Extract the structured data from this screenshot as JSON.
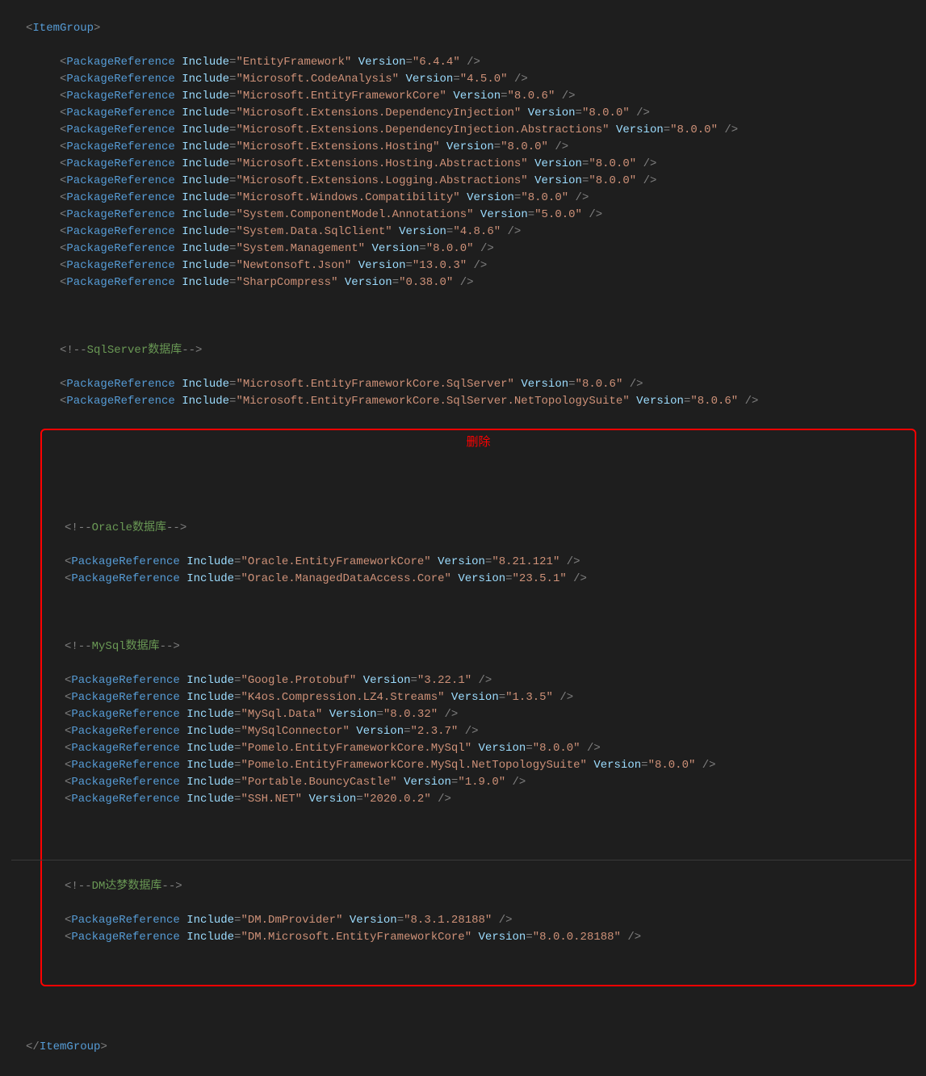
{
  "delete_label": "删除",
  "tags": {
    "itemgroup_open": "ItemGroup",
    "itemgroup_close": "ItemGroup",
    "pkg": "PackageReference",
    "include": "Include",
    "version": "Version"
  },
  "comments": {
    "sqlserver": "SqlServer数据库",
    "oracle": "Oracle数据库",
    "mysql": "MySql数据库",
    "dm": "DM达梦数据库"
  },
  "packages": {
    "base": [
      {
        "include": "EntityFramework",
        "version": "6.4.4"
      },
      {
        "include": "Microsoft.CodeAnalysis",
        "version": "4.5.0"
      },
      {
        "include": "Microsoft.EntityFrameworkCore",
        "version": "8.0.6"
      },
      {
        "include": "Microsoft.Extensions.DependencyInjection",
        "version": "8.0.0"
      },
      {
        "include": "Microsoft.Extensions.DependencyInjection.Abstractions",
        "version": "8.0.0"
      },
      {
        "include": "Microsoft.Extensions.Hosting",
        "version": "8.0.0"
      },
      {
        "include": "Microsoft.Extensions.Hosting.Abstractions",
        "version": "8.0.0"
      },
      {
        "include": "Microsoft.Extensions.Logging.Abstractions",
        "version": "8.0.0"
      },
      {
        "include": "Microsoft.Windows.Compatibility",
        "version": "8.0.0"
      },
      {
        "include": "System.ComponentModel.Annotations",
        "version": "5.0.0"
      },
      {
        "include": "System.Data.SqlClient",
        "version": "4.8.6"
      },
      {
        "include": "System.Management",
        "version": "8.0.0"
      },
      {
        "include": "Newtonsoft.Json",
        "version": "13.0.3"
      },
      {
        "include": "SharpCompress",
        "version": "0.38.0"
      }
    ],
    "sqlserver": [
      {
        "include": "Microsoft.EntityFrameworkCore.SqlServer",
        "version": "8.0.6"
      },
      {
        "include": "Microsoft.EntityFrameworkCore.SqlServer.NetTopologySuite",
        "version": "8.0.6"
      }
    ],
    "oracle": [
      {
        "include": "Oracle.EntityFrameworkCore",
        "version": "8.21.121"
      },
      {
        "include": "Oracle.ManagedDataAccess.Core",
        "version": "23.5.1"
      }
    ],
    "mysql": [
      {
        "include": "Google.Protobuf",
        "version": "3.22.1"
      },
      {
        "include": "K4os.Compression.LZ4.Streams",
        "version": "1.3.5"
      },
      {
        "include": "MySql.Data",
        "version": "8.0.32"
      },
      {
        "include": "MySqlConnector",
        "version": "2.3.7"
      },
      {
        "include": "Pomelo.EntityFrameworkCore.MySql",
        "version": "8.0.0"
      },
      {
        "include": "Pomelo.EntityFrameworkCore.MySql.NetTopologySuite",
        "version": "8.0.0"
      },
      {
        "include": "Portable.BouncyCastle",
        "version": "1.9.0"
      },
      {
        "include": "SSH.NET",
        "version": "2020.0.2"
      }
    ],
    "dm": [
      {
        "include": "DM.DmProvider",
        "version": "8.3.1.28188"
      },
      {
        "include": "DM.Microsoft.EntityFrameworkCore",
        "version": "8.0.0.28188"
      }
    ]
  }
}
